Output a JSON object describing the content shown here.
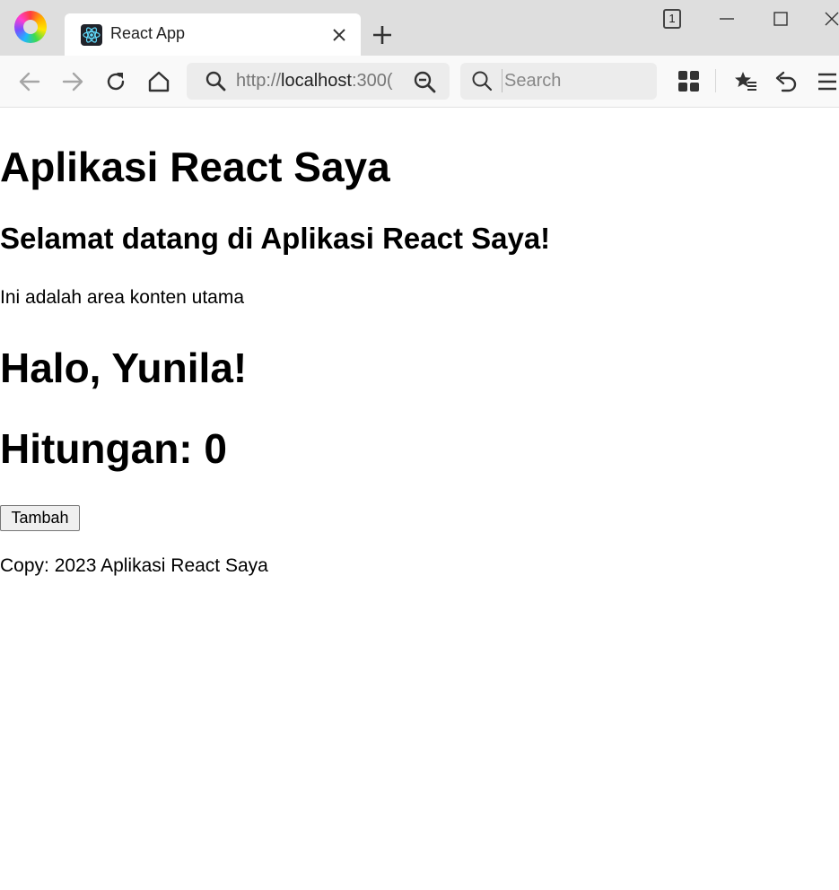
{
  "browser": {
    "tab": {
      "title": "React App"
    },
    "tab_count": "1",
    "address": {
      "scheme": "http://",
      "host": "localhost",
      "port_visible": ":300("
    },
    "search": {
      "placeholder": "Search"
    },
    "icons": {
      "logo": "browser-logo",
      "favicon": "react-favicon",
      "tab_close": "close-icon",
      "new_tab": "plus-icon",
      "back": "back-arrow-icon",
      "forward": "forward-arrow-icon",
      "reload": "reload-icon",
      "home": "home-icon",
      "address_search": "search-icon",
      "zoom": "zoom-out-icon",
      "search_box": "search-icon",
      "extensions": "grid-icon",
      "bookmarks": "star-list-icon",
      "undo": "undo-icon",
      "menu": "hamburger-icon"
    }
  },
  "page": {
    "app_title": "Aplikasi React Saya",
    "welcome": "Selamat datang di Aplikasi React Saya!",
    "content_text": "Ini adalah area konten utama",
    "greeting": "Halo, Yunila!",
    "counter": "Hitungan: 0",
    "add_button_label": "Tambah",
    "footer": "Copy: 2023 Aplikasi React Saya"
  }
}
